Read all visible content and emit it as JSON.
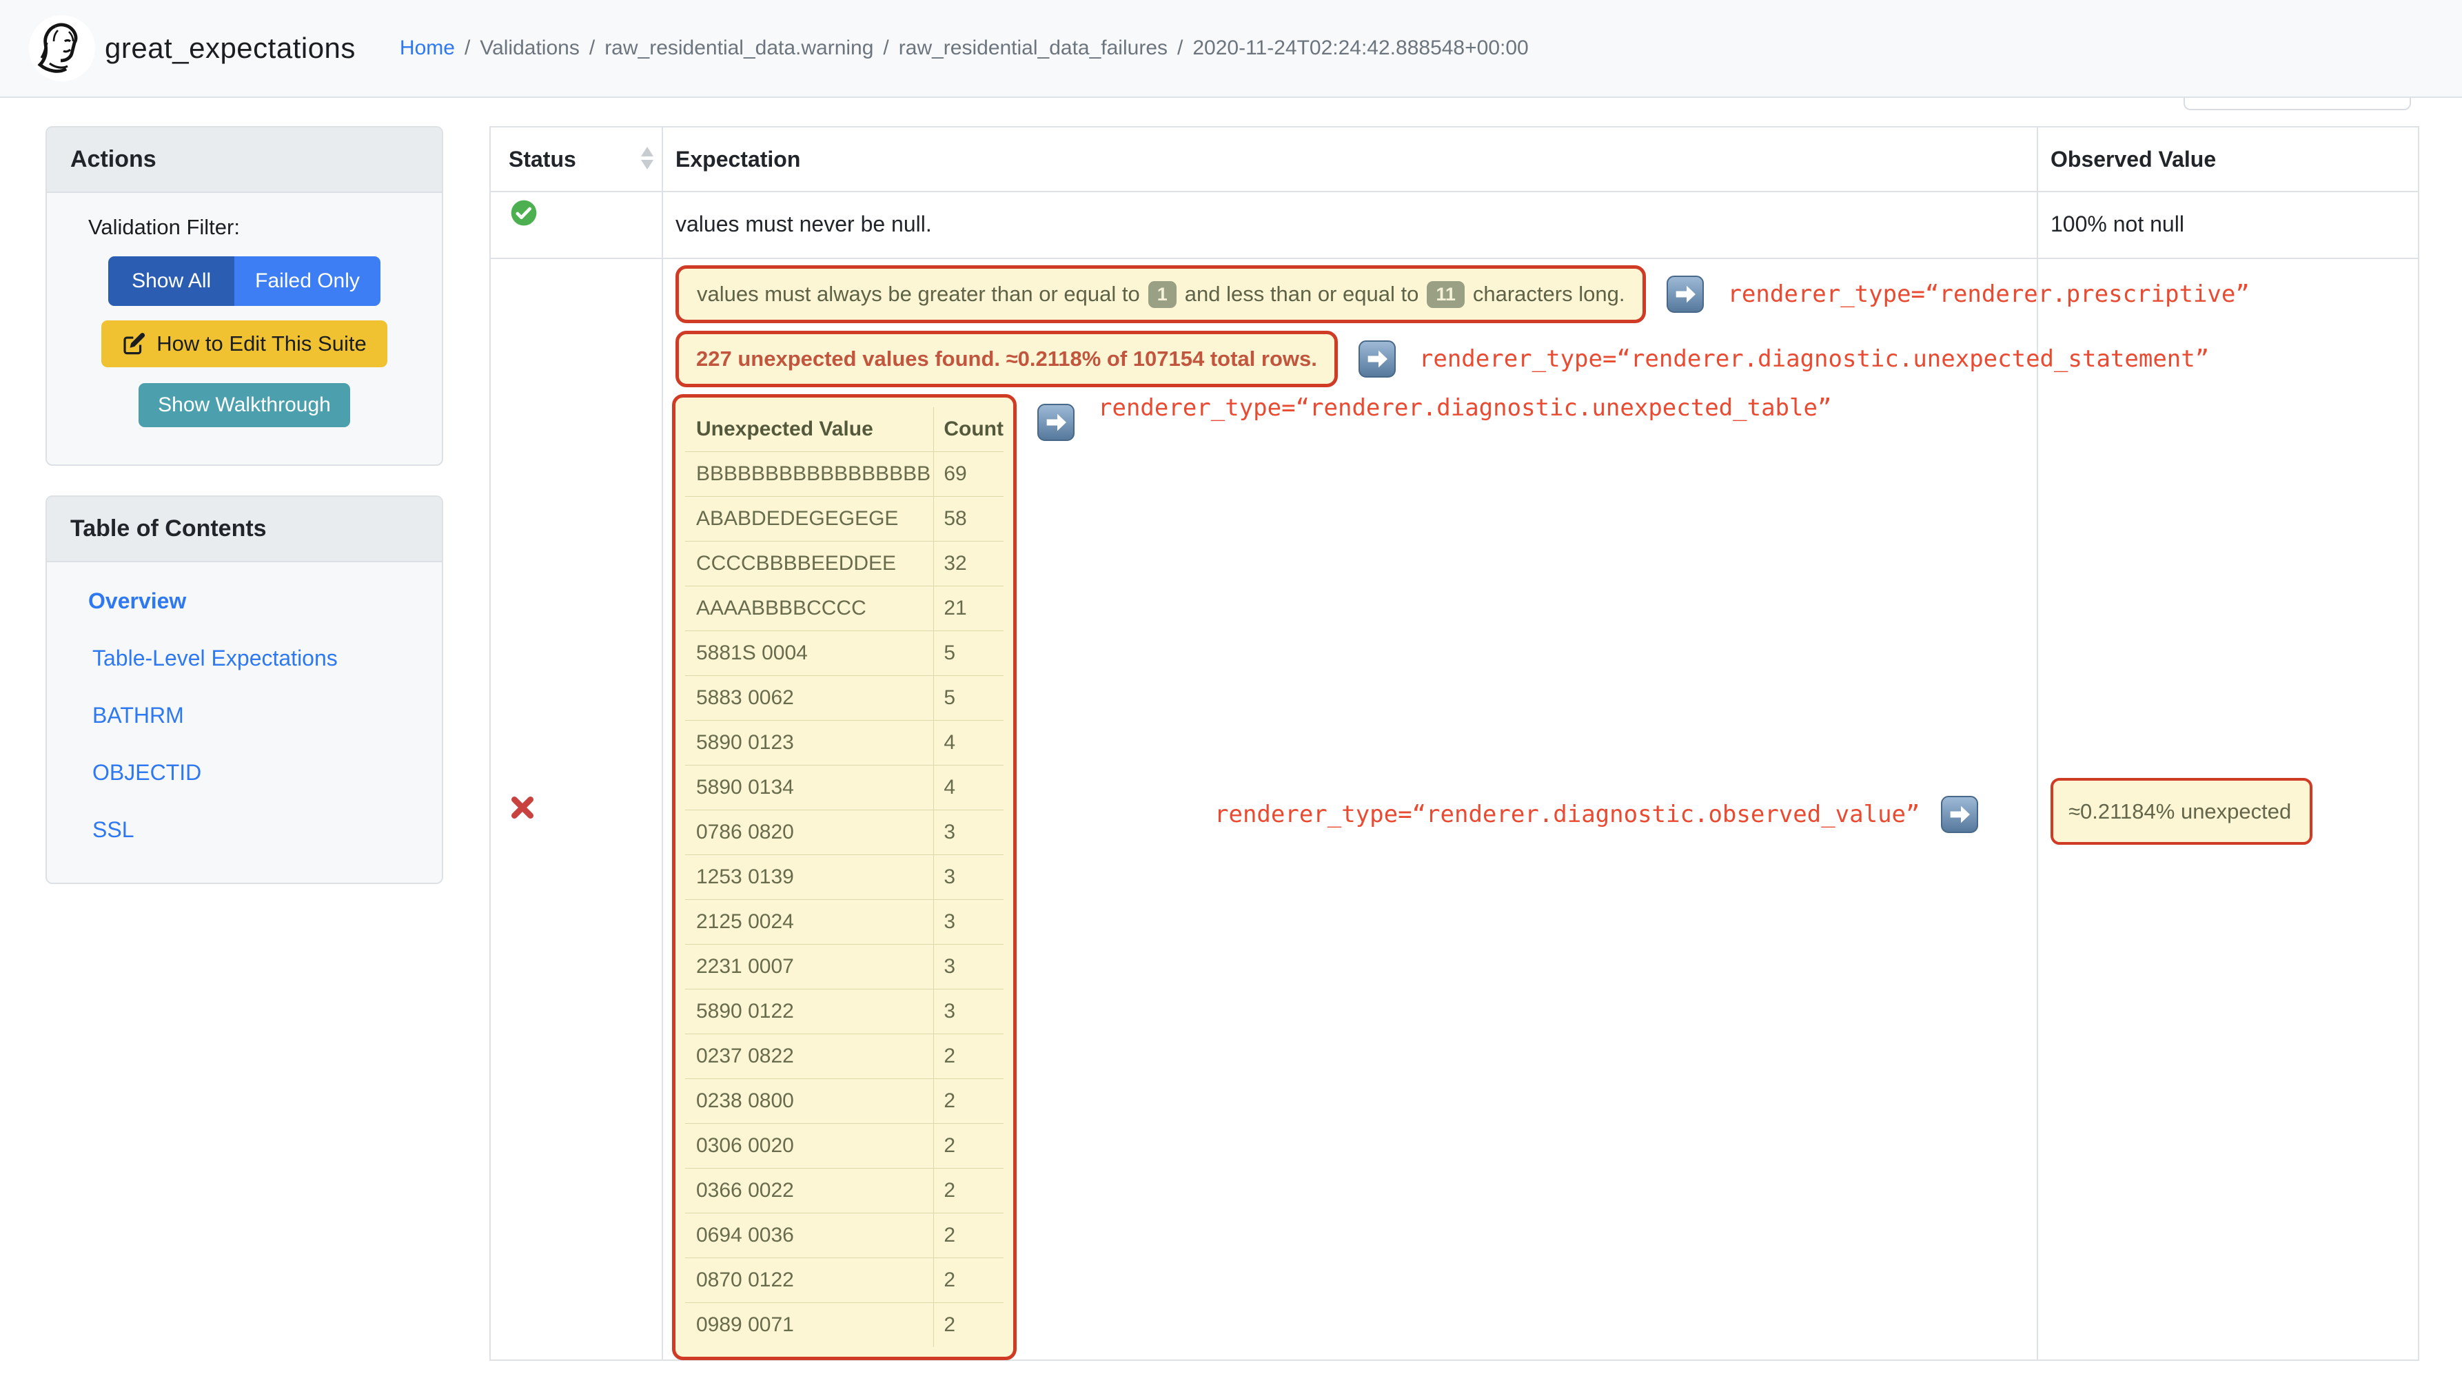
{
  "colors": {
    "page-bg": "#ffffff",
    "navbar-bg": "#f8f9fa",
    "border-gray": "#dee2e6",
    "panel-header-bg": "#e9ecef",
    "panel-body-bg": "#f7f8f9",
    "text-dark": "#212529",
    "text-muted": "#6c757d",
    "link-blue": "#2e79f1",
    "btn-showall-bg": "#2b5eb3",
    "btn-failedonly-bg": "#3e7ef5",
    "btn-edit-bg": "#f0c232",
    "btn-walkthrough-bg": "#4c9fad",
    "highlight-bg": "#fcf6d4",
    "highlight-border": "#d03b26",
    "olive-text": "#5e6246",
    "olive-table-text": "#686c4c",
    "badge-bg": "#9aa083",
    "badge-text": "#f5f2d9",
    "statement-red": "#c2553e",
    "code-red": "#e94b32",
    "success-green": "#4caf50",
    "fail-red": "#c8423f",
    "table-divider": "#ddd8a8",
    "arrow-top": "#9db9d6",
    "arrow-bottom": "#56799c"
  },
  "navbar": {
    "brand": "great_expectations",
    "breadcrumb": {
      "home": "Home",
      "sep": "/",
      "items": [
        "Validations",
        "raw_residential_data.warning",
        "raw_residential_data_failures",
        "2020-11-24T02:24:42.888548+00:00"
      ]
    }
  },
  "sidebar": {
    "actions": {
      "title": "Actions",
      "filter_label": "Validation Filter:",
      "show_all": "Show All",
      "failed_only": "Failed Only",
      "edit_button": "How to Edit This Suite",
      "walkthrough_button": "Show Walkthrough"
    },
    "toc": {
      "title": "Table of Contents",
      "items": [
        {
          "label": "Overview"
        },
        {
          "label": "Table-Level Expectations"
        },
        {
          "label": "BATHRM"
        },
        {
          "label": "OBJECTID"
        },
        {
          "label": "SSL"
        }
      ]
    }
  },
  "table": {
    "headers": {
      "status": "Status",
      "expectation": "Expectation",
      "observed": "Observed Value"
    },
    "row1": {
      "expectation": "values must never be null.",
      "observed": "100% not null"
    },
    "row2": {
      "prescriptive": {
        "text_before": "values must always be greater than or equal to",
        "badge1": "1",
        "text_middle": "and less than or equal to",
        "badge2": "11",
        "text_after": "characters long.",
        "renderer": "renderer_type=“renderer.prescriptive”"
      },
      "statement": {
        "text": "227 unexpected values found. ≈0.2118% of 107154 total rows.",
        "renderer": "renderer_type=“renderer.diagnostic.unexpected_statement”"
      },
      "unexpected_table": {
        "col_value": "Unexpected Value",
        "col_count": "Count",
        "renderer": "renderer_type=“renderer.diagnostic.unexpected_table”",
        "rows": [
          [
            "BBBBBBBBBBBBBBBBB",
            "69"
          ],
          [
            "ABABDEDEGEGEGE",
            "58"
          ],
          [
            "CCCCBBBBEEDDEE",
            "32"
          ],
          [
            "AAAABBBBCCCC",
            "21"
          ],
          [
            "5881S 0004",
            "5"
          ],
          [
            "5883 0062",
            "5"
          ],
          [
            "5890 0123",
            "4"
          ],
          [
            "5890 0134",
            "4"
          ],
          [
            "0786 0820",
            "3"
          ],
          [
            "1253 0139",
            "3"
          ],
          [
            "2125 0024",
            "3"
          ],
          [
            "2231 0007",
            "3"
          ],
          [
            "5890 0122",
            "3"
          ],
          [
            "0237 0822",
            "2"
          ],
          [
            "0238 0800",
            "2"
          ],
          [
            "0306 0020",
            "2"
          ],
          [
            "0366 0022",
            "2"
          ],
          [
            "0694 0036",
            "2"
          ],
          [
            "0870 0122",
            "2"
          ],
          [
            "0989 0071",
            "2"
          ]
        ]
      },
      "observed": {
        "renderer": "renderer_type=“renderer.diagnostic.observed_value”",
        "value": "≈0.21184% unexpected"
      }
    }
  }
}
